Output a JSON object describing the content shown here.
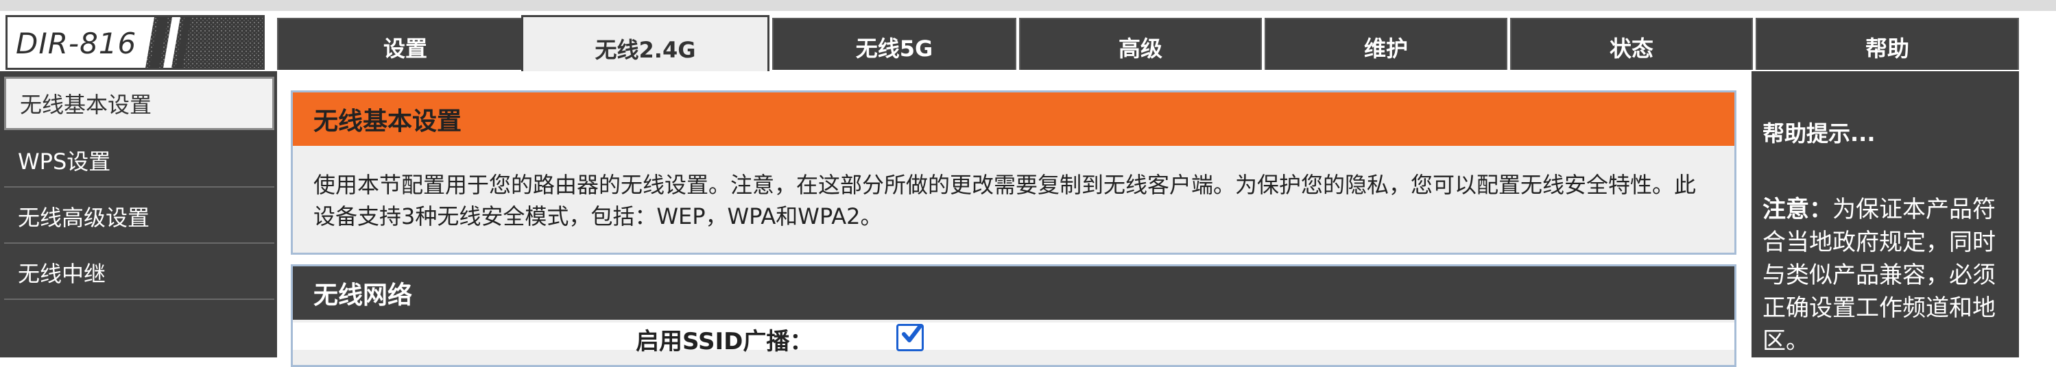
{
  "logo": {
    "text": "DIR-816"
  },
  "tabs": [
    {
      "label": "设置"
    },
    {
      "label": "无线2.4G"
    },
    {
      "label": "无线5G"
    },
    {
      "label": "高级"
    },
    {
      "label": "维护"
    },
    {
      "label": "状态"
    },
    {
      "label": "帮助"
    }
  ],
  "sidebar": {
    "items": [
      {
        "label": "无线基本设置"
      },
      {
        "label": "WPS设置"
      },
      {
        "label": "无线高级设置"
      },
      {
        "label": "无线中继"
      }
    ]
  },
  "main": {
    "basic": {
      "title": "无线基本设置",
      "desc": "使用本节配置用于您的路由器的无线设置。注意，在这部分所做的更改需要复制到无线客户端。为保护您的隐私，您可以配置无线安全特性。此设备支持3种无线安全模式，包括：WEP，WPA和WPA2。"
    },
    "network": {
      "title": "无线网络",
      "ssid_label": "启用SSID广播：",
      "ssid_checked": true
    }
  },
  "help": {
    "title": "帮助提示...",
    "note_label": "注意：",
    "note_text": "为保证本产品符合当地政府规定，同时与类似产品兼容，必须正确设置工作频道和地区。"
  },
  "colors": {
    "dark": "#404040",
    "orange": "#f26b22",
    "panel_bg": "#efefef",
    "checkbox": "#1a5fd1"
  }
}
